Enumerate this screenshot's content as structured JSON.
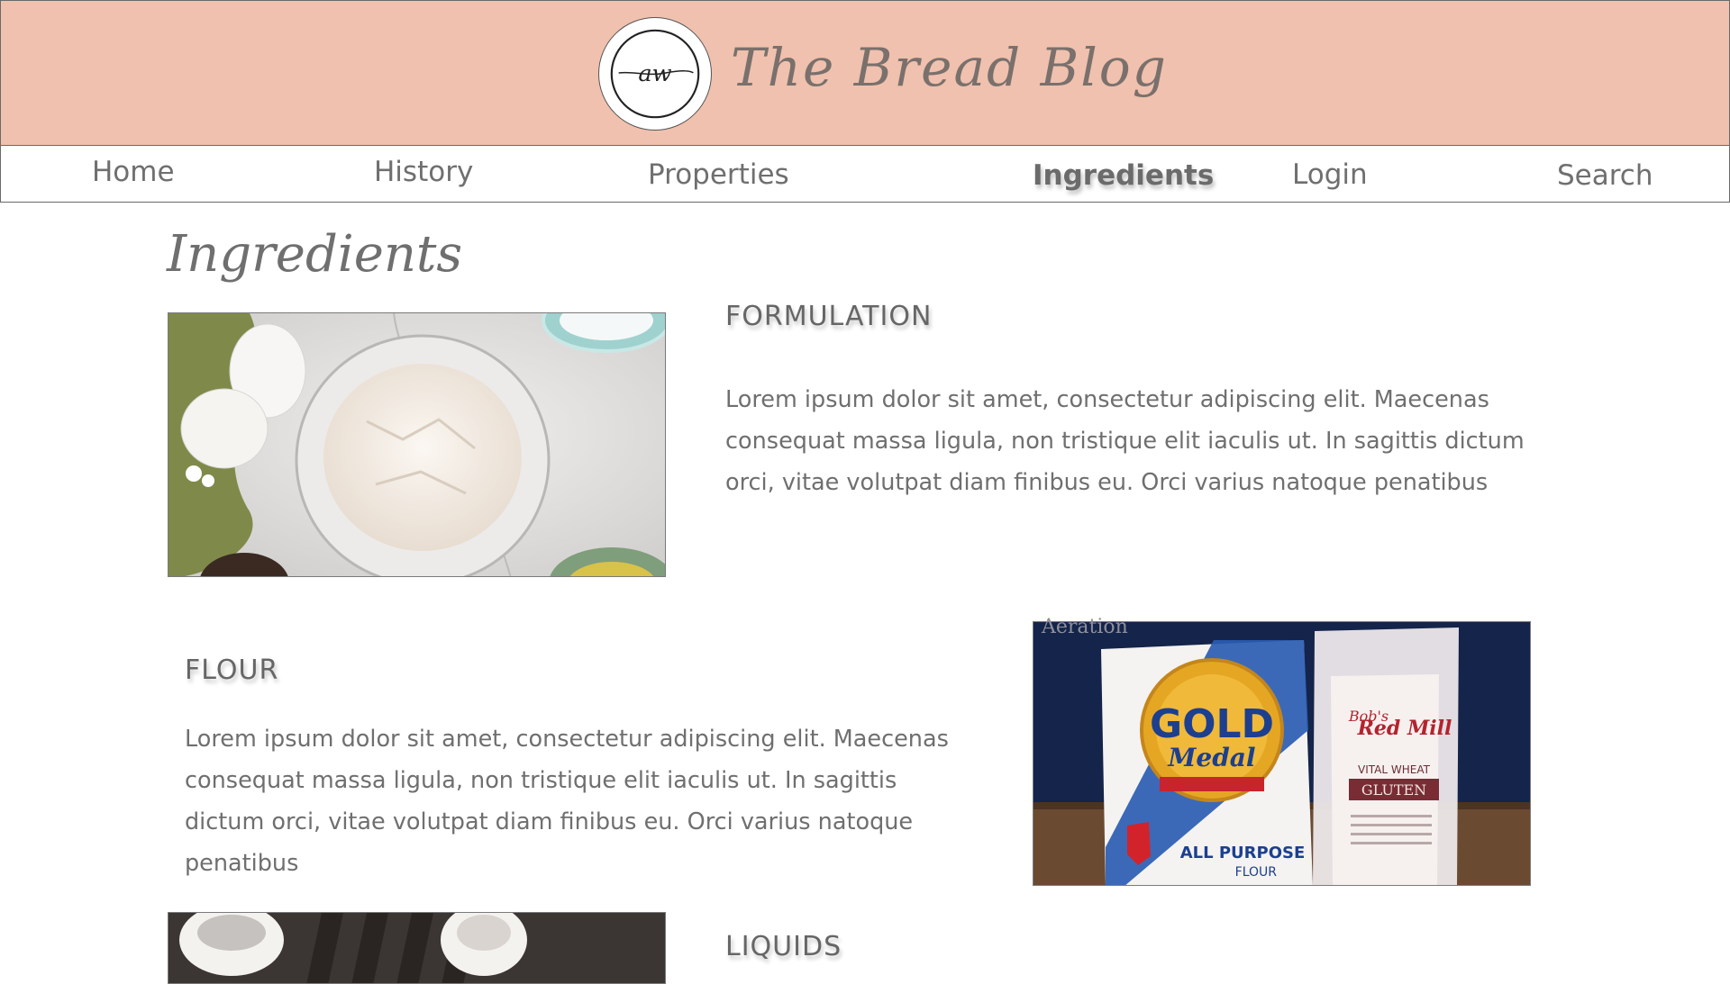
{
  "header": {
    "logo_text": "aw",
    "site_title": "The Bread Blog"
  },
  "nav": {
    "items": [
      {
        "label": "Home"
      },
      {
        "label": "History"
      },
      {
        "label": "Properties"
      },
      {
        "label": "Ingredients",
        "active": true
      },
      {
        "label": "Login"
      },
      {
        "label": "Search"
      }
    ]
  },
  "page": {
    "heading": "Ingredients"
  },
  "sections": [
    {
      "title": "FORMULATION",
      "body": "Lorem ipsum dolor sit amet, consectetur adipiscing elit. Maecenas consequat massa ligula, non tristique elit iaculis ut. In sagittis dictum orci, vitae volutpat diam finibus eu. Orci varius natoque penatibus"
    },
    {
      "title": "FLOUR",
      "body": "Lorem ipsum dolor sit amet, consectetur adipiscing elit. Maecenas consequat massa ligula, non tristique elit iaculis ut. In sagittis dictum orci, vitae volutpat diam finibus eu. Orci varius natoque penatibus",
      "image_caption": "Aeration"
    },
    {
      "title": "LIQUIDS"
    }
  ],
  "images": {
    "flour_bag_1": {
      "brand": "GOLD",
      "sub": "Medal",
      "line": "ALL PURPOSE",
      "line2": "FLOUR"
    },
    "flour_bag_2": {
      "brand": "Bob's",
      "sub": "Red Mill",
      "line": "VITAL WHEAT",
      "line2": "GLUTEN"
    }
  },
  "colors": {
    "header_bg": "#efc1ae",
    "text": "#6f6f6f"
  }
}
